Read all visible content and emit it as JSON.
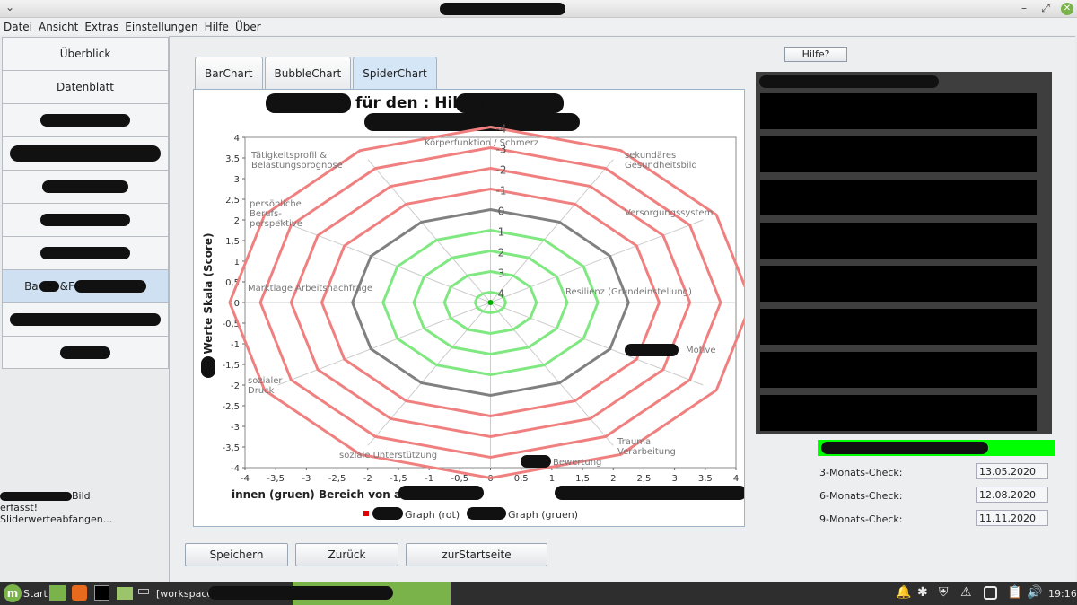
{
  "menu": [
    "Datei",
    "Ansicht",
    "Extras",
    "Einstellungen",
    "Hilfe",
    "Über"
  ],
  "sidebar": {
    "items": [
      {
        "label": "Überblick"
      },
      {
        "label": "Datenblatt"
      },
      {
        "label": ""
      },
      {
        "label": ""
      },
      {
        "label": ""
      },
      {
        "label": ""
      },
      {
        "label": ""
      },
      {
        "label": "Ba",
        "label_end": "&F",
        "active": true
      },
      {
        "label": ""
      },
      {
        "label": ""
      }
    ],
    "status_lines": [
      "Bild",
      "erfasst!",
      "Sliderwerteabfangen..."
    ]
  },
  "tabs": [
    {
      "label": "BarChart"
    },
    {
      "label": "BubbleChart"
    },
    {
      "label": "SpiderChart",
      "active": true
    }
  ],
  "chart_data": {
    "type": "radar",
    "title_line1": "für den : Hilfen zur",
    "xlabel": "innen (gruen) Bereich von aussen:",
    "ylabel": "Werte Skala (Score)",
    "x_ticks": [
      "-4",
      "-3,5",
      "-3",
      "-2,5",
      "-2",
      "-1,5",
      "-1",
      "-0,5",
      "0",
      "0,5",
      "1",
      "1,5",
      "2",
      "2,5",
      "3",
      "3,5",
      "4"
    ],
    "y_ticks": [
      "4",
      "3,5",
      "3",
      "2,5",
      "2",
      "1,5",
      "1",
      "0,5",
      "0",
      "-0,5",
      "-1",
      "-1,5",
      "-2",
      "-2,5",
      "-3",
      "-3,5",
      "-4"
    ],
    "radial_ticks": [
      "-4",
      "-3",
      "-2",
      "-1",
      "0",
      "1",
      "2",
      "3",
      "4"
    ],
    "axes": [
      "Körperfunktion / Schmerz",
      "sekundäres Gesundheitsbild",
      "Versorgungssystem",
      "Resilienz (Grundeinstellung)",
      "Motive",
      "Trauma Verarbeitung",
      "Bewertung",
      "soziale Unterstützung",
      "sozialer Druck",
      "Marktlage  Arbeitsnachfrage",
      "persönliche Berufs- perspektive",
      "Tätigkeitsprofil & Belastungsprognose"
    ],
    "axes_redacted_prefix": [
      "",
      "",
      "",
      "",
      "",
      "",
      "",
      "",
      "",
      "",
      "",
      ""
    ],
    "rings": [
      {
        "value": -4,
        "color": "#f08080"
      },
      {
        "value": -3,
        "color": "#f08080"
      },
      {
        "value": -2,
        "color": "#f08080"
      },
      {
        "value": -1,
        "color": "#f08080"
      },
      {
        "value": 0,
        "color": "#808080"
      },
      {
        "value": 1,
        "color": "#80e880"
      },
      {
        "value": 2,
        "color": "#80e880"
      },
      {
        "value": 3,
        "color": "#80e880"
      },
      {
        "value": 4,
        "color": "#80e880"
      }
    ],
    "legend": [
      {
        "label": "Graph (rot)",
        "color": "#e00000"
      },
      {
        "label": "Graph (gruen)",
        "color": "#000000"
      }
    ],
    "series_green_point": [
      0,
      0
    ]
  },
  "buttons": {
    "save": "Speichern",
    "back": "Zurück",
    "home": "zurStartseite",
    "help": "Hilfe?"
  },
  "checks": [
    {
      "label": "3-Monats-Check:",
      "value": "13.05.2020"
    },
    {
      "label": "6-Monats-Check:",
      "value": "12.08.2020"
    },
    {
      "label": "9-Monats-Check:",
      "value": "11.11.2020"
    }
  ],
  "taskbar": {
    "start": "Start",
    "window": "[workspace",
    "clock": "19:16"
  }
}
